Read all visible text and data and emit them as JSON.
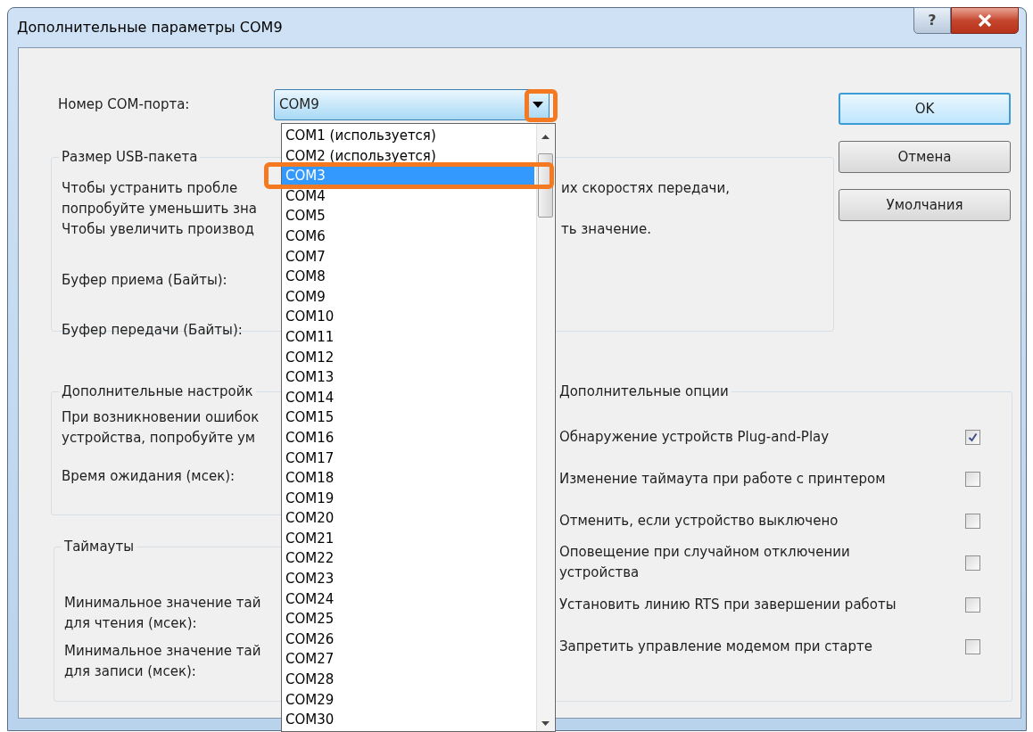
{
  "window": {
    "title": "Дополнительные параметры COM9",
    "help_button": "?"
  },
  "port": {
    "label": "Номер COM-порта:",
    "value": "COM9",
    "expanded": true
  },
  "port_list": [
    {
      "label": "COM1 (используется)",
      "selected": false
    },
    {
      "label": "COM2 (используется)",
      "selected": false
    },
    {
      "label": "COM3",
      "selected": true
    },
    {
      "label": "COM4",
      "selected": false
    },
    {
      "label": "COM5",
      "selected": false
    },
    {
      "label": "COM6",
      "selected": false
    },
    {
      "label": "COM7",
      "selected": false
    },
    {
      "label": "COM8",
      "selected": false
    },
    {
      "label": "COM9",
      "selected": false
    },
    {
      "label": "COM10",
      "selected": false
    },
    {
      "label": "COM11",
      "selected": false
    },
    {
      "label": "COM12",
      "selected": false
    },
    {
      "label": "COM13",
      "selected": false
    },
    {
      "label": "COM14",
      "selected": false
    },
    {
      "label": "COM15",
      "selected": false
    },
    {
      "label": "COM16",
      "selected": false
    },
    {
      "label": "COM17",
      "selected": false
    },
    {
      "label": "COM18",
      "selected": false
    },
    {
      "label": "COM19",
      "selected": false
    },
    {
      "label": "COM20",
      "selected": false
    },
    {
      "label": "COM21",
      "selected": false
    },
    {
      "label": "COM22",
      "selected": false
    },
    {
      "label": "COM23",
      "selected": false
    },
    {
      "label": "COM24",
      "selected": false
    },
    {
      "label": "COM25",
      "selected": false
    },
    {
      "label": "COM26",
      "selected": false
    },
    {
      "label": "COM27",
      "selected": false
    },
    {
      "label": "COM28",
      "selected": false
    },
    {
      "label": "COM29",
      "selected": false
    },
    {
      "label": "COM30",
      "selected": false
    }
  ],
  "buttons": [
    {
      "label": "OK",
      "default": true
    },
    {
      "label": "Отмена",
      "default": false
    },
    {
      "label": "Умолчания",
      "default": false
    }
  ],
  "usb_group": {
    "title": "Размер USB-пакета",
    "left_texts": [
      "Чтобы устранить пробле\nпопробуйте уменьшить зна",
      "Чтобы увеличить производ"
    ],
    "right_texts": [
      "их скоростях передачи,",
      "ть значение."
    ],
    "fields": [
      "Буфер приема (Байты):",
      "Буфер передачи (Байты):"
    ]
  },
  "advanced_settings": {
    "title": "Дополнительные настройк",
    "text": "При возникновении ошибок\nустройства, попробуйте ум",
    "field": "Время ожидания (мсек):"
  },
  "timeouts": {
    "title": "Таймауты",
    "fields": [
      "Минимальное значение тай\nдля чтения (мсек):",
      "Минимальное значение тай\nдля записи (мсек):"
    ]
  },
  "options": {
    "title": "Дополнительные опции",
    "items": [
      {
        "label": "Обнаружение устройств Plug-and-Play",
        "checked": true
      },
      {
        "label": "Изменение таймаута при работе с принтером",
        "checked": false
      },
      {
        "label": "Отменить, если устройство выключено",
        "checked": false
      },
      {
        "label": "Оповещение при случайном отключении\nустройства",
        "checked": false
      },
      {
        "label": "Установить линию RTS при завершении работы",
        "checked": false
      },
      {
        "label": "Запретить управление модемом при старте",
        "checked": false
      }
    ]
  }
}
